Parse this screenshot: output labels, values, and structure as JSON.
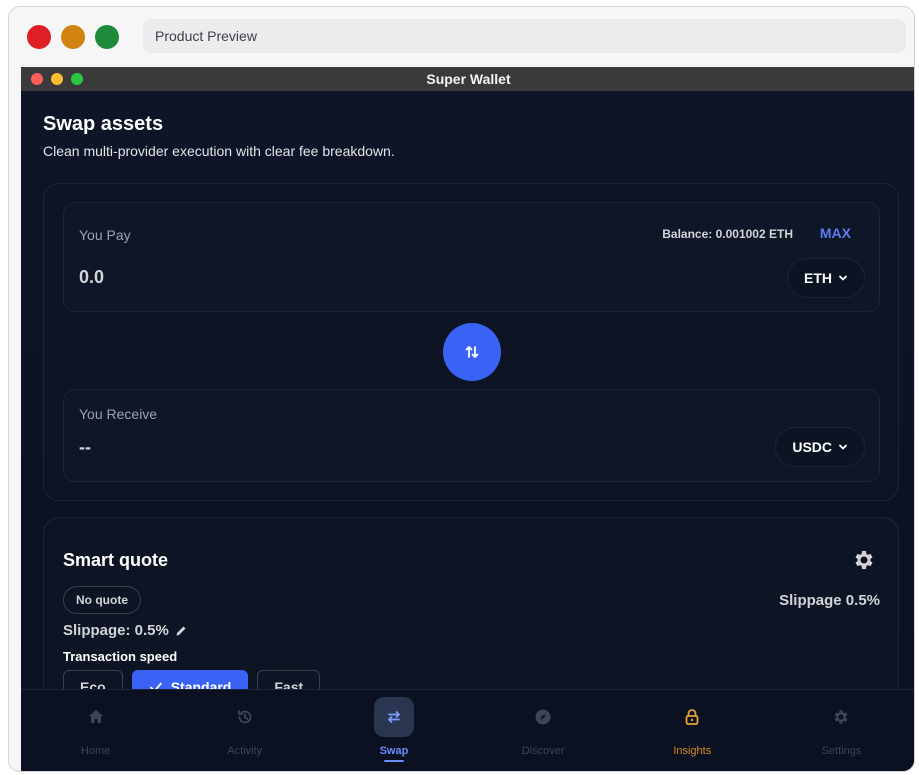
{
  "browser": {
    "url_text": "Product Preview"
  },
  "window": {
    "title": "Super Wallet"
  },
  "header": {
    "title": "Swap assets",
    "subtitle": "Clean multi-provider execution with clear fee breakdown."
  },
  "pay": {
    "label": "You Pay",
    "balance": "Balance: 0.001002 ETH",
    "max_label": "MAX",
    "amount": "0.0",
    "token": "ETH"
  },
  "receive": {
    "label": "You Receive",
    "amount": "--",
    "token": "USDC"
  },
  "quote": {
    "title": "Smart quote",
    "badge": "No quote",
    "slippage_right": "Slippage 0.5%",
    "slippage_left": "Slippage: 0.5%",
    "speed_label": "Transaction speed",
    "speeds": [
      {
        "label": "Eco",
        "selected": false
      },
      {
        "label": "Standard",
        "selected": true
      },
      {
        "label": "Fast",
        "selected": false
      }
    ]
  },
  "nav": {
    "items": [
      {
        "label": "Home",
        "icon": "home-icon"
      },
      {
        "label": "Activity",
        "icon": "history-icon"
      },
      {
        "label": "Swap",
        "icon": "swap-icon",
        "active": true
      },
      {
        "label": "Discover",
        "icon": "compass-icon"
      },
      {
        "label": "Insights",
        "icon": "lock-icon",
        "highlight": true
      },
      {
        "label": "Settings",
        "icon": "gear-icon"
      }
    ]
  },
  "colors": {
    "accent": "#3a63f5",
    "background": "#0b1120",
    "insights": "#d08a1e"
  }
}
